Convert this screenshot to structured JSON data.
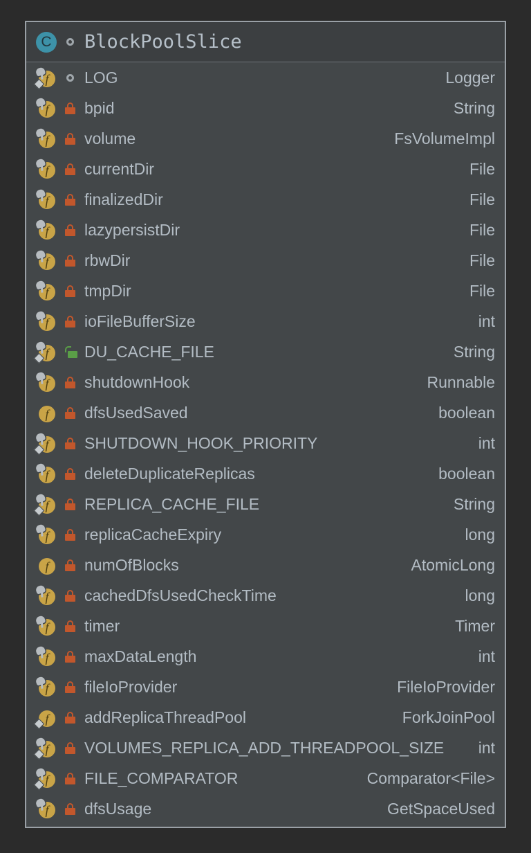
{
  "popup": {
    "kind": "structure-popup",
    "colors": {
      "window_background": "#2b2b2b",
      "panel_background": "#434749",
      "header_background": "#3c3f41",
      "border": "#9aa0a6",
      "text": "#b3bcc4",
      "class_icon": "#3d92a8",
      "field_icon": "#c9a447",
      "private_lock": "#c2572c",
      "public_lock": "#5a9e47",
      "modifier_marker": "#b7bcc0"
    }
  },
  "header": {
    "icon": "class-icon",
    "icon_letter": "C",
    "visibility": "package-private",
    "visibility_icon": "package-private-circle-icon",
    "name": "BlockPoolSlice"
  },
  "members": [
    {
      "icon": "field-icon",
      "icon_letter": "f",
      "static": true,
      "final": true,
      "visibility": "package-private",
      "name": "LOG",
      "type": "Logger"
    },
    {
      "icon": "field-icon",
      "icon_letter": "f",
      "static": true,
      "final": false,
      "visibility": "private",
      "name": "bpid",
      "type": "String"
    },
    {
      "icon": "field-icon",
      "icon_letter": "f",
      "static": true,
      "final": false,
      "visibility": "private",
      "name": "volume",
      "type": "FsVolumeImpl"
    },
    {
      "icon": "field-icon",
      "icon_letter": "f",
      "static": true,
      "final": false,
      "visibility": "private",
      "name": "currentDir",
      "type": "File"
    },
    {
      "icon": "field-icon",
      "icon_letter": "f",
      "static": true,
      "final": false,
      "visibility": "private",
      "name": "finalizedDir",
      "type": "File"
    },
    {
      "icon": "field-icon",
      "icon_letter": "f",
      "static": true,
      "final": false,
      "visibility": "private",
      "name": "lazypersistDir",
      "type": "File"
    },
    {
      "icon": "field-icon",
      "icon_letter": "f",
      "static": true,
      "final": false,
      "visibility": "private",
      "name": "rbwDir",
      "type": "File"
    },
    {
      "icon": "field-icon",
      "icon_letter": "f",
      "static": true,
      "final": false,
      "visibility": "private",
      "name": "tmpDir",
      "type": "File"
    },
    {
      "icon": "field-icon",
      "icon_letter": "f",
      "static": true,
      "final": false,
      "visibility": "private",
      "name": "ioFileBufferSize",
      "type": "int"
    },
    {
      "icon": "field-icon",
      "icon_letter": "f",
      "static": true,
      "final": true,
      "visibility": "public",
      "name": "DU_CACHE_FILE",
      "type": "String"
    },
    {
      "icon": "field-icon",
      "icon_letter": "f",
      "static": true,
      "final": false,
      "visibility": "private",
      "name": "shutdownHook",
      "type": "Runnable"
    },
    {
      "icon": "field-icon",
      "icon_letter": "f",
      "static": false,
      "final": false,
      "visibility": "private",
      "name": "dfsUsedSaved",
      "type": "boolean"
    },
    {
      "icon": "field-icon",
      "icon_letter": "f",
      "static": true,
      "final": true,
      "visibility": "private",
      "name": "SHUTDOWN_HOOK_PRIORITY",
      "type": "int"
    },
    {
      "icon": "field-icon",
      "icon_letter": "f",
      "static": true,
      "final": false,
      "visibility": "private",
      "name": "deleteDuplicateReplicas",
      "type": "boolean"
    },
    {
      "icon": "field-icon",
      "icon_letter": "f",
      "static": true,
      "final": true,
      "visibility": "private",
      "name": "REPLICA_CACHE_FILE",
      "type": "String"
    },
    {
      "icon": "field-icon",
      "icon_letter": "f",
      "static": true,
      "final": false,
      "visibility": "private",
      "name": "replicaCacheExpiry",
      "type": "long"
    },
    {
      "icon": "field-icon",
      "icon_letter": "f",
      "static": false,
      "final": false,
      "visibility": "private",
      "name": "numOfBlocks",
      "type": "AtomicLong"
    },
    {
      "icon": "field-icon",
      "icon_letter": "f",
      "static": true,
      "final": false,
      "visibility": "private",
      "name": "cachedDfsUsedCheckTime",
      "type": "long"
    },
    {
      "icon": "field-icon",
      "icon_letter": "f",
      "static": true,
      "final": false,
      "visibility": "private",
      "name": "timer",
      "type": "Timer"
    },
    {
      "icon": "field-icon",
      "icon_letter": "f",
      "static": true,
      "final": false,
      "visibility": "private",
      "name": "maxDataLength",
      "type": "int"
    },
    {
      "icon": "field-icon",
      "icon_letter": "f",
      "static": true,
      "final": false,
      "visibility": "private",
      "name": "fileIoProvider",
      "type": "FileIoProvider"
    },
    {
      "icon": "field-icon",
      "icon_letter": "f",
      "static": false,
      "final": true,
      "visibility": "private",
      "name": "addReplicaThreadPool",
      "type": "ForkJoinPool"
    },
    {
      "icon": "field-icon",
      "icon_letter": "f",
      "static": true,
      "final": true,
      "visibility": "private",
      "name": "VOLUMES_REPLICA_ADD_THREADPOOL_SIZE",
      "type": "int"
    },
    {
      "icon": "field-icon",
      "icon_letter": "f",
      "static": true,
      "final": true,
      "visibility": "private",
      "name": "FILE_COMPARATOR",
      "type": "Comparator<File>"
    },
    {
      "icon": "field-icon",
      "icon_letter": "f",
      "static": true,
      "final": false,
      "visibility": "private",
      "name": "dfsUsage",
      "type": "GetSpaceUsed"
    }
  ]
}
